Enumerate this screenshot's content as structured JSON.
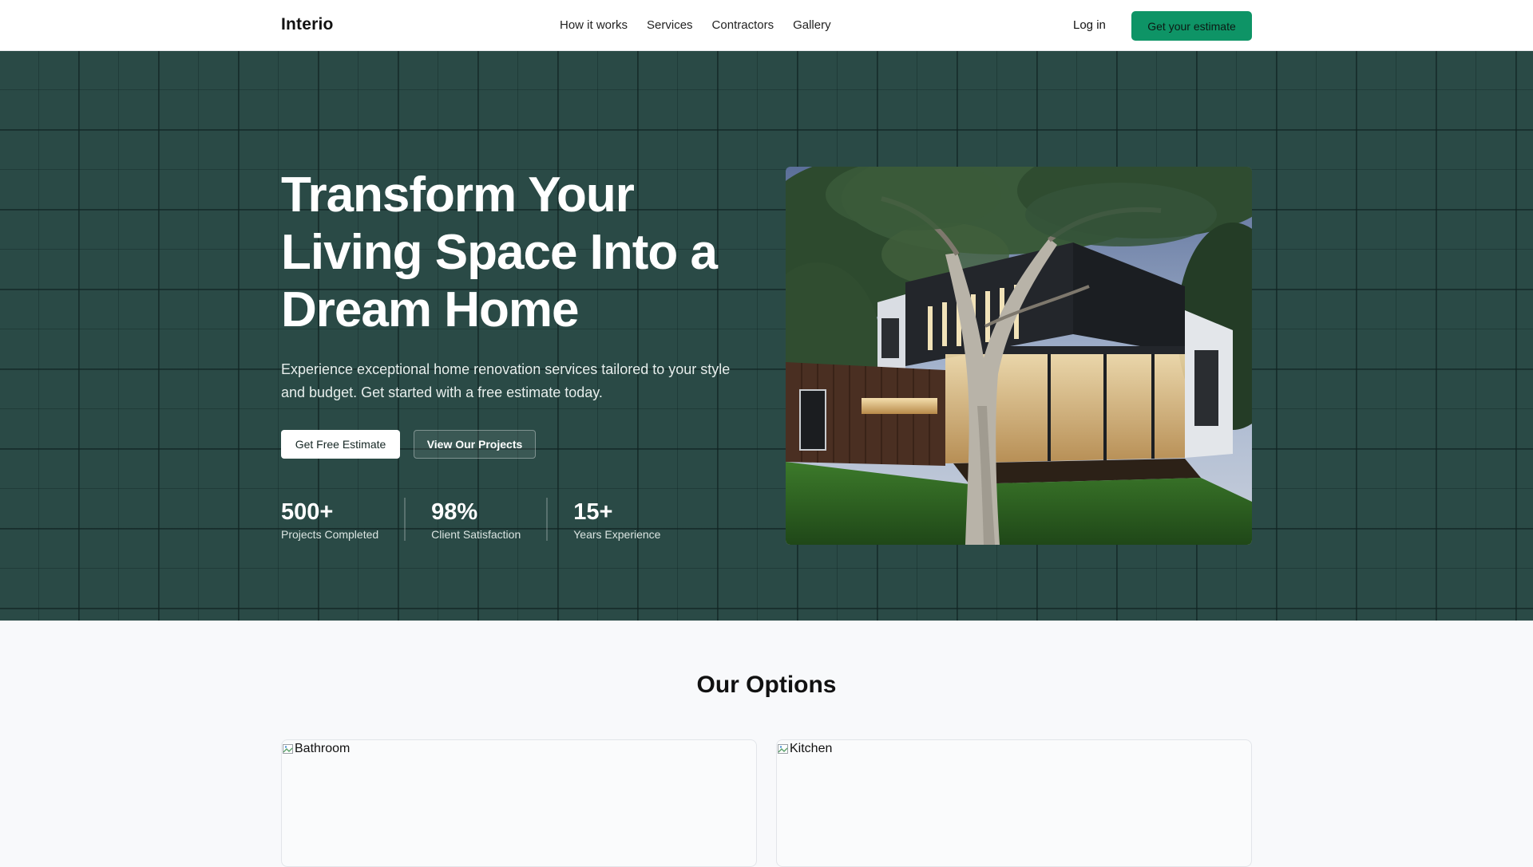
{
  "header": {
    "brand": "Interio",
    "nav": [
      "How it works",
      "Services",
      "Contractors",
      "Gallery"
    ],
    "login_label": "Log in",
    "cta_label": "Get your estimate"
  },
  "hero": {
    "title": "Transform Your Living Space Into a Dream Home",
    "subtitle": "Experience exceptional home renovation services tailored to your style and budget. Get started with a free estimate today.",
    "primary_button": "Get Free Estimate",
    "secondary_button": "View Our Projects",
    "stats": [
      {
        "value": "500+",
        "label": "Projects Completed"
      },
      {
        "value": "98%",
        "label": "Client Satisfaction"
      },
      {
        "value": "15+",
        "label": "Years Experience"
      }
    ]
  },
  "options": {
    "title": "Our Options",
    "cards": [
      {
        "alt": "Bathroom"
      },
      {
        "alt": "Kitchen"
      }
    ]
  },
  "colors": {
    "accent": "#0e9466",
    "hero_bg": "#2a4a46"
  }
}
